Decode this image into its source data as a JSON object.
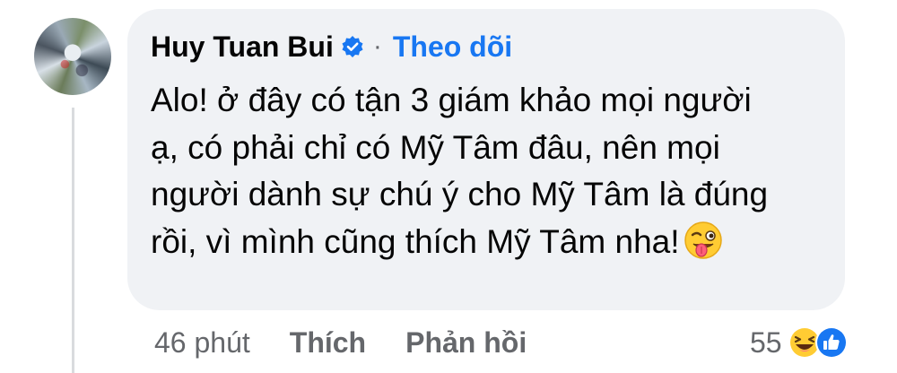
{
  "comment": {
    "author": "Huy Tuan Bui",
    "separator": "·",
    "follow_label": "Theo dõi",
    "text": "Alo! ở đây có tận 3 giám khảo mọi người ạ, có phải chỉ có Mỹ Tâm đâu, nên mọi người dành sự chú ý cho Mỹ Tâm là đúng rồi, vì mình cũng thích Mỹ Tâm nha!",
    "emoji": "wink-tongue-emoji"
  },
  "actions": {
    "timestamp": "46 phút",
    "like_label": "Thích",
    "reply_label": "Phản hồi"
  },
  "reactions": {
    "count": "55",
    "icons": [
      "haha-reaction-icon",
      "like-reaction-icon"
    ]
  },
  "colors": {
    "bubble": "#f0f2f5",
    "link": "#1877f2",
    "secondary_text": "#65676b",
    "verified": "#1877f2"
  }
}
